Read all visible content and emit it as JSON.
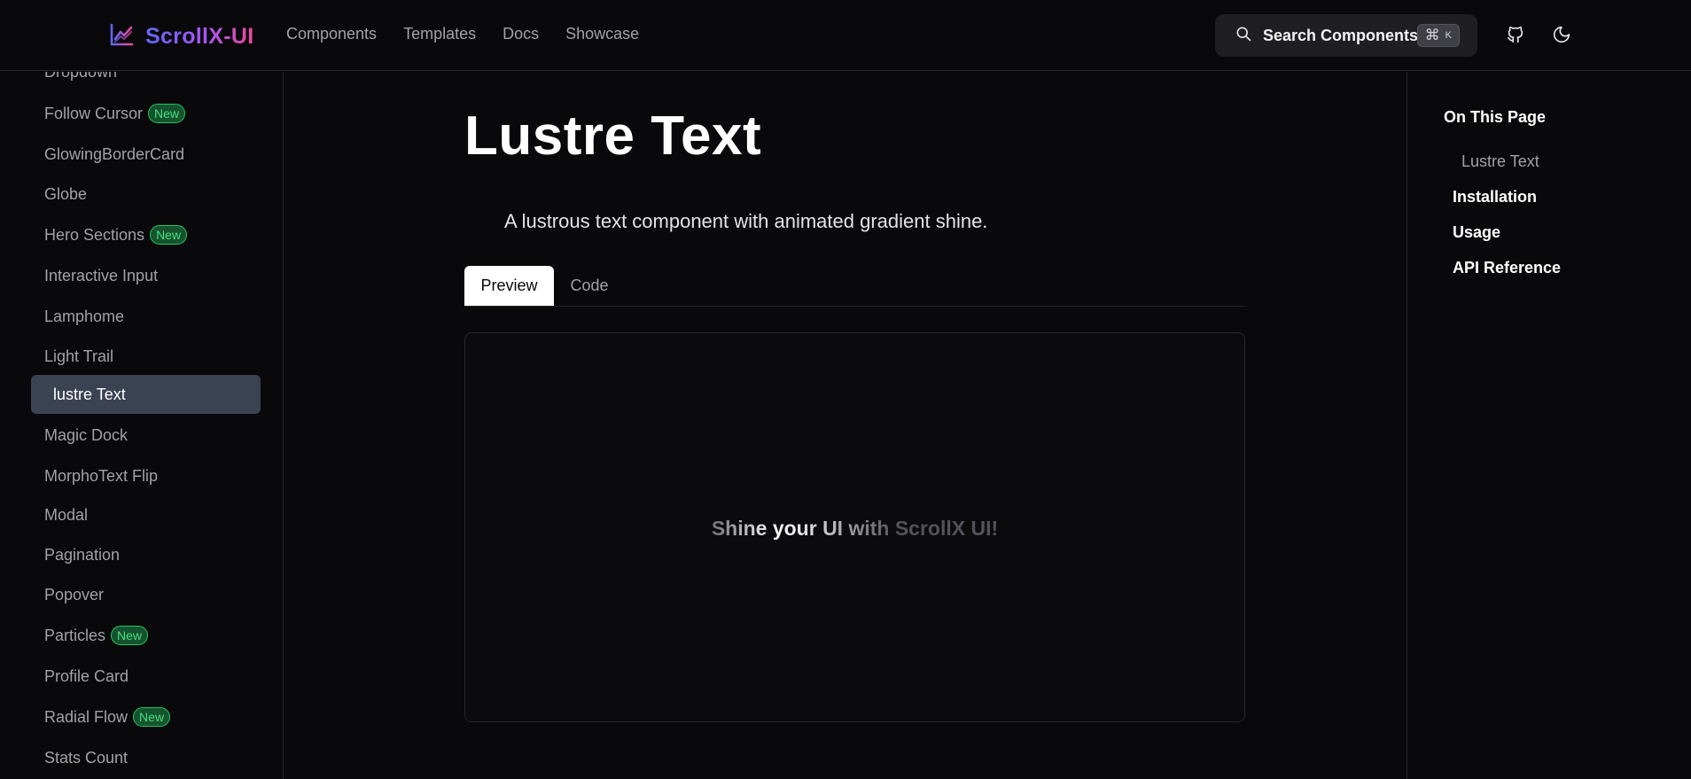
{
  "header": {
    "logo_text": "ScrollX-UI",
    "nav": [
      "Components",
      "Templates",
      "Docs",
      "Showcase"
    ],
    "search_label": "Search Components",
    "shortcut_cmd": "⌘",
    "shortcut_key": "K"
  },
  "sidebar": {
    "new_badge": "New",
    "items": [
      {
        "label": "Dropdown"
      },
      {
        "label": "Follow Cursor",
        "badge": "New"
      },
      {
        "label": "GlowingBorderCard"
      },
      {
        "label": "Globe"
      },
      {
        "label": "Hero Sections",
        "badge": "New"
      },
      {
        "label": "Interactive Input"
      },
      {
        "label": "Lamphome"
      },
      {
        "label": "Light Trail"
      },
      {
        "label": "lustre Text",
        "active": true
      },
      {
        "label": "Magic Dock"
      },
      {
        "label": "MorphoText Flip"
      },
      {
        "label": "Modal"
      },
      {
        "label": "Pagination"
      },
      {
        "label": "Popover"
      },
      {
        "label": "Particles",
        "badge": "New"
      },
      {
        "label": "Profile Card"
      },
      {
        "label": "Radial Flow",
        "badge": "New"
      },
      {
        "label": "Stats Count"
      }
    ]
  },
  "main": {
    "title": "Lustre Text",
    "description": "A lustrous text component with animated gradient shine.",
    "tabs": [
      "Preview",
      "Code"
    ],
    "preview_text": "Shine your UI with ScrollX UI!"
  },
  "toc": {
    "title": "On This Page",
    "items": [
      "Lustre Text",
      "Installation",
      "Usage",
      "API Reference"
    ]
  },
  "colors": {
    "background": "#09090b",
    "active_sidebar": "#3b4252",
    "badge_green": "#4ade80",
    "logo_gradient": [
      "#6366f1",
      "#a855f7",
      "#ec4899"
    ]
  }
}
